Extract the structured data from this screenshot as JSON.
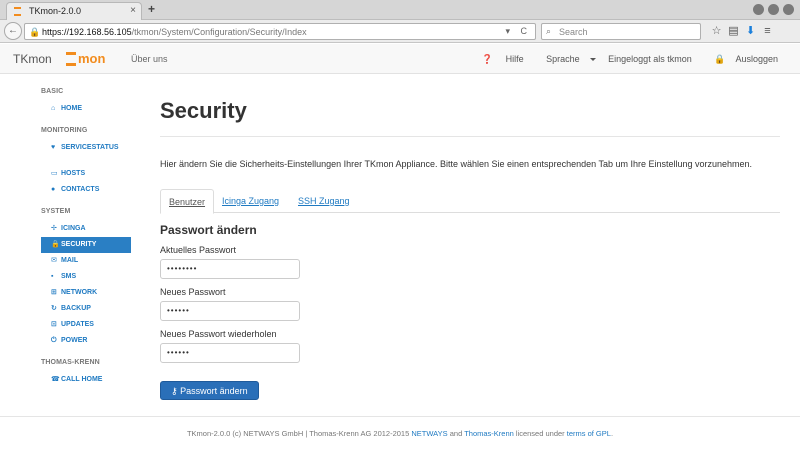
{
  "browser": {
    "tab_title": "TKmon-2.0.0",
    "tab_close": "×",
    "new_tab": "+",
    "url_host": "https://192.168.56.105",
    "url_path": "/tkmon/System/Configuration/Security/Index",
    "url_btns": "▾ C",
    "search_placeholder": "Search"
  },
  "header": {
    "brand": "TKmon",
    "logo_text": "mon",
    "about": "Über uns",
    "help": "Hilfe",
    "language": "Sprache",
    "logged_in": "Eingeloggt als tkmon",
    "logout": "Ausloggen"
  },
  "sidebar": {
    "sections": {
      "basic": "BASIC",
      "monitoring": "MONITORING",
      "system": "SYSTEM",
      "thomas_krenn": "THOMAS-KRENN"
    },
    "items": {
      "home": "HOME",
      "servicestatus": "SERVICESTATUS",
      "hosts": "HOSTS",
      "contacts": "CONTACTS",
      "icinga": "ICINGA",
      "security": "SECURITY",
      "mail": "MAIL",
      "sms": "SMS",
      "network": "NETWORK",
      "backup": "BACKUP",
      "updates": "UPDATES",
      "power": "POWER",
      "call_home": "CALL HOME"
    }
  },
  "main": {
    "title": "Security",
    "intro": "Hier ändern Sie die Sicherheits-Einstellungen Ihrer TKmon Appliance. Bitte wählen Sie einen entsprechenden Tab um Ihre Einstellung vorzunehmen.",
    "tabs": [
      "Benutzer",
      "Icinga Zugang",
      "SSH Zugang"
    ],
    "form_title": "Passwort ändern",
    "current_pw_label": "Aktuelles Passwort",
    "current_pw_value": "••••••••",
    "new_pw_label": "Neues Passwort",
    "new_pw_value": "••••••",
    "repeat_pw_label": "Neues Passwort wiederholen",
    "repeat_pw_value": "••••••",
    "submit": "Passwort ändern"
  },
  "footer": {
    "text1": "TKmon-2.0.0 (c) NETWAYS GmbH | Thomas-Krenn AG 2012-2015 ",
    "link_netways": "NETWAYS",
    "text2": " and ",
    "link_tk": "Thomas-Krenn",
    "text3": " licensed under ",
    "link_gpl": "terms of GPL",
    "text4": "."
  },
  "colors": {
    "accent": "#2a7fc4",
    "brand_orange": "#f28c1e"
  }
}
